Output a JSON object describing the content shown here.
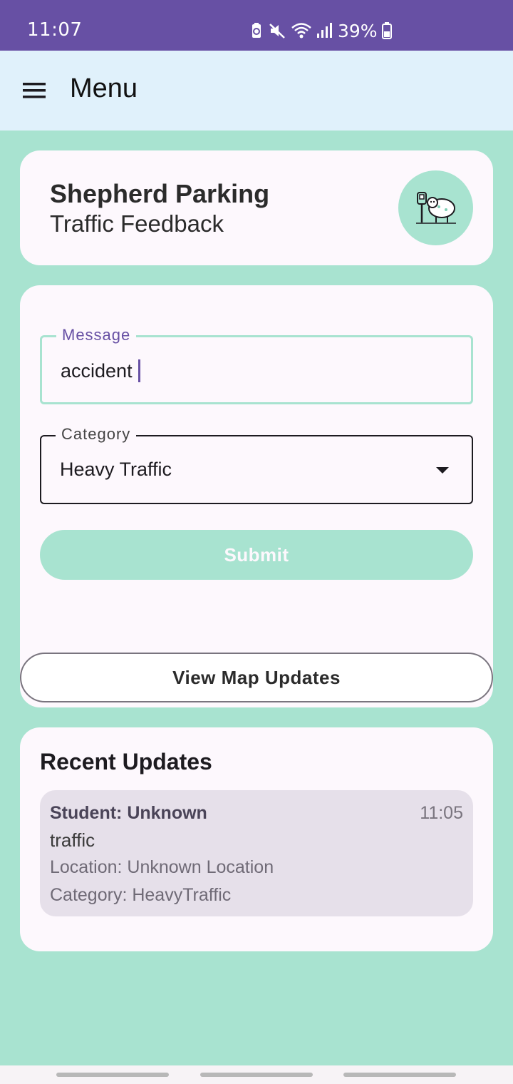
{
  "status_bar": {
    "time": "11:07",
    "battery": "39%",
    "icons": [
      "battery-saver-icon",
      "mute-icon",
      "wifi-icon",
      "signal-icon",
      "battery-icon"
    ]
  },
  "app_bar": {
    "title": "Menu",
    "menu_icon": "hamburger-menu-icon"
  },
  "header": {
    "title": "Shepherd Parking",
    "subtitle": "Traffic Feedback",
    "logo_icon": "sheep-parking-meter-icon"
  },
  "form": {
    "message_label": "Message",
    "message_value": "accident",
    "category_label": "Category",
    "category_value": "Heavy Traffic",
    "submit_label": "Submit"
  },
  "map_button_label": "View Map Updates",
  "recent_updates": {
    "title": "Recent Updates",
    "items": [
      {
        "author": "Student: Unknown",
        "time": "11:05",
        "message": "traffic",
        "location": "Location: Unknown Location",
        "category": "Category: HeavyTraffic"
      }
    ]
  },
  "colors": {
    "primary": "#6750a4",
    "accent": "#a8e3d0",
    "app_bar": "#e0f1fb",
    "surface": "#fdf8fd"
  }
}
